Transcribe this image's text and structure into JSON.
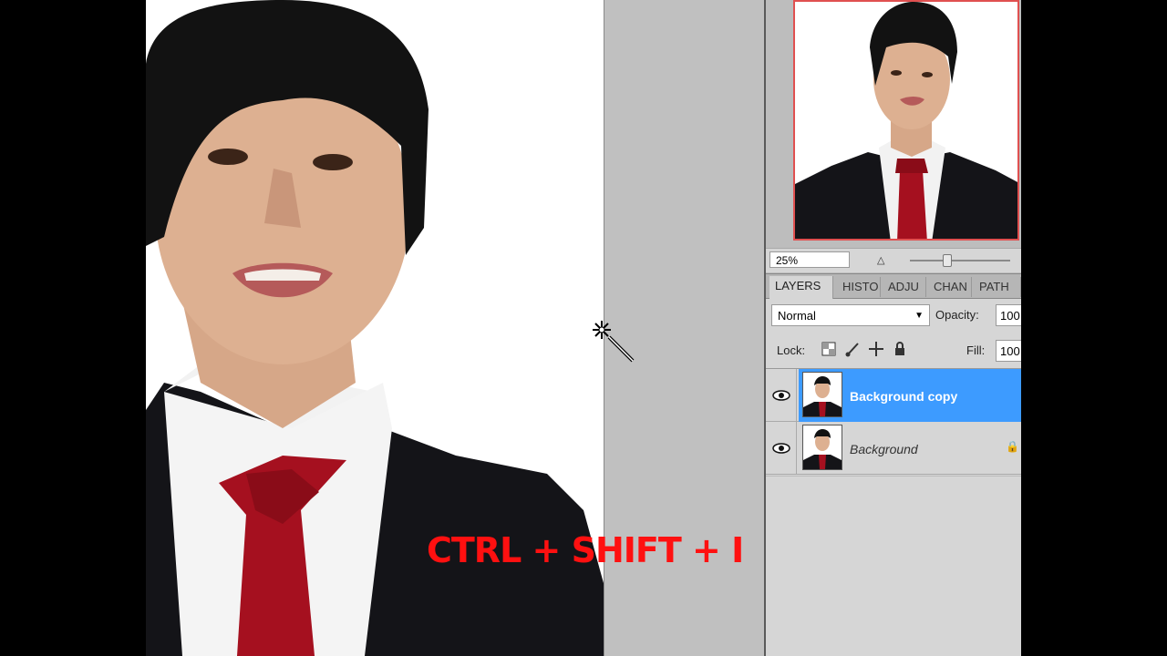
{
  "overlay": {
    "shortcut_text": "CTRL + SHIFT + I"
  },
  "navigator": {
    "zoom_value": "25%"
  },
  "layers_panel": {
    "tabs": [
      {
        "label": "LAYERS",
        "active": true
      },
      {
        "label": "HISTO",
        "active": false
      },
      {
        "label": "ADJU",
        "active": false
      },
      {
        "label": "CHAN",
        "active": false
      },
      {
        "label": "PATH",
        "active": false
      }
    ],
    "blend_mode": "Normal",
    "opacity_label": "Opacity:",
    "opacity_value": "100",
    "lock_label": "Lock:",
    "fill_label": "Fill:",
    "fill_value": "100",
    "layers": [
      {
        "name": "Background copy",
        "selected": true,
        "visible": true,
        "locked": false
      },
      {
        "name": "Background",
        "selected": false,
        "visible": true,
        "locked": true
      }
    ]
  },
  "icons": {
    "cursor": "magic-wand-icon",
    "visibility": "eye-icon",
    "lock_transparent": "checker-lock-icon",
    "lock_brush": "brush-lock-icon",
    "lock_move": "move-lock-icon",
    "lock_all": "padlock-icon"
  },
  "colors": {
    "shortcut_red": "#ff1010",
    "selected_layer": "#3d9bff",
    "navigator_frame": "#e05050",
    "tie_red": "#a5101f",
    "suit": "#141418"
  }
}
